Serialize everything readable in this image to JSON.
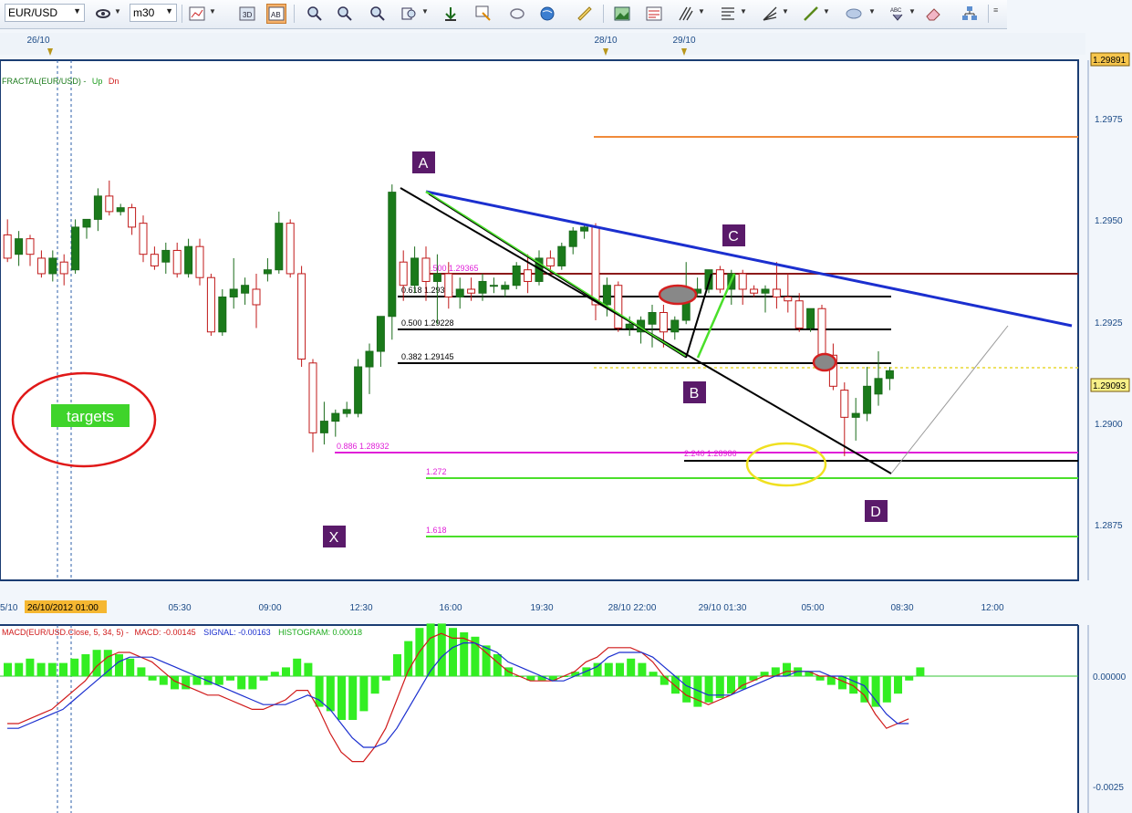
{
  "toolbar": {
    "symbol": "EUR/USD",
    "timeframe": "m30",
    "buttons": [
      "crosshair-icon",
      "bar-chart-icon",
      "candle-chart-icon",
      "line-chart-icon",
      "zoom-in-icon",
      "zoom-out-icon",
      "zoom-icon",
      "scroll-end-icon",
      "bring-to-front-icon",
      "hand-icon",
      "globe-icon",
      "ruler-icon",
      "image-icon",
      "template-icon",
      "trend-tool-icon",
      "fibonacci-icon",
      "gann-fan-icon",
      "line-icon",
      "ellipse-icon",
      "text-icon",
      "eraser-icon",
      "objects-icon"
    ]
  },
  "main_chart": {
    "indicator_label": "FRACTAL(EUR/USD) -",
    "indicator_up": "Up",
    "indicator_dn": "Dn",
    "price_axis": [
      "1.2975",
      "1.2950",
      "1.2925",
      "1.2900",
      "1.2875"
    ],
    "price_top_flag": "1.29891",
    "price_current_flag": "1.29093",
    "date_markers": [
      "26/10",
      "28/10",
      "29/10"
    ],
    "time_axis": [
      "5/10",
      "05:30",
      "09:00",
      "12:30",
      "16:00",
      "19:30",
      "28/10 22:00",
      "29/10 01:30",
      "05:00",
      "08:30",
      "12:00"
    ],
    "cursor_time": "26/10/2012 01:00",
    "pattern_points": {
      "A": "A",
      "B": "B",
      "C": "C",
      "D": "D",
      "X": "X"
    },
    "targets_label": "targets",
    "fib_labels": {
      "f500_top": "0.500 1.29365",
      "f618": "0.618 1.29311",
      "f500": "0.500 1.29228",
      "f382": "0.382 1.29145",
      "f886": "0.886 1.28932",
      "f2240": "2.240 1.28986",
      "f1272": "1.272",
      "f1618": "1.618"
    }
  },
  "macd_panel": {
    "label_name": "MACD(EUR/USD.Close, 5, 34, 5) -",
    "label_macd": "MACD: -0.00145",
    "label_signal": "SIGNAL: -0.00163",
    "label_hist": "HISTOGRAM: 0.00018",
    "axis": [
      "0.00000",
      "-0.0025"
    ]
  },
  "chart_data": {
    "type": "candlestick",
    "symbol": "EUR/USD",
    "timeframe": "m30",
    "ylim": [
      1.2856,
      1.299
    ],
    "candles": [
      {
        "o": 1.2945,
        "h": 1.2949,
        "l": 1.2938,
        "c": 1.2939
      },
      {
        "o": 1.294,
        "h": 1.2946,
        "l": 1.2937,
        "c": 1.2944
      },
      {
        "o": 1.2944,
        "h": 1.2945,
        "l": 1.2937,
        "c": 1.294
      },
      {
        "o": 1.2939,
        "h": 1.2941,
        "l": 1.2934,
        "c": 1.2935
      },
      {
        "o": 1.2935,
        "h": 1.2941,
        "l": 1.2933,
        "c": 1.2939
      },
      {
        "o": 1.2938,
        "h": 1.294,
        "l": 1.2932,
        "c": 1.2935
      },
      {
        "o": 1.2936,
        "h": 1.2949,
        "l": 1.2935,
        "c": 1.2947
      },
      {
        "o": 1.2947,
        "h": 1.2949,
        "l": 1.2944,
        "c": 1.2949
      },
      {
        "o": 1.2949,
        "h": 1.2957,
        "l": 1.2946,
        "c": 1.2955
      },
      {
        "o": 1.2955,
        "h": 1.2959,
        "l": 1.295,
        "c": 1.2951
      },
      {
        "o": 1.2951,
        "h": 1.2953,
        "l": 1.295,
        "c": 1.2952
      },
      {
        "o": 1.2952,
        "h": 1.2953,
        "l": 1.2945,
        "c": 1.2947
      },
      {
        "o": 1.2948,
        "h": 1.295,
        "l": 1.2938,
        "c": 1.294
      },
      {
        "o": 1.294,
        "h": 1.2942,
        "l": 1.2936,
        "c": 1.2937
      },
      {
        "o": 1.2938,
        "h": 1.2943,
        "l": 1.2935,
        "c": 1.2941
      },
      {
        "o": 1.2941,
        "h": 1.2943,
        "l": 1.2934,
        "c": 1.2935
      },
      {
        "o": 1.2935,
        "h": 1.2944,
        "l": 1.2934,
        "c": 1.2942
      },
      {
        "o": 1.2942,
        "h": 1.2944,
        "l": 1.2932,
        "c": 1.2934
      },
      {
        "o": 1.2934,
        "h": 1.2935,
        "l": 1.2919,
        "c": 1.292
      },
      {
        "o": 1.292,
        "h": 1.2931,
        "l": 1.2919,
        "c": 1.2929
      },
      {
        "o": 1.2929,
        "h": 1.2939,
        "l": 1.2926,
        "c": 1.2931
      },
      {
        "o": 1.293,
        "h": 1.2934,
        "l": 1.2927,
        "c": 1.2932
      },
      {
        "o": 1.2931,
        "h": 1.2935,
        "l": 1.2921,
        "c": 1.2927
      },
      {
        "o": 1.2935,
        "h": 1.2939,
        "l": 1.2933,
        "c": 1.2936
      },
      {
        "o": 1.2936,
        "h": 1.2951,
        "l": 1.2935,
        "c": 1.2948
      },
      {
        "o": 1.2948,
        "h": 1.2949,
        "l": 1.2934,
        "c": 1.2935
      },
      {
        "o": 1.2935,
        "h": 1.2937,
        "l": 1.2911,
        "c": 1.2913
      },
      {
        "o": 1.2912,
        "h": 1.2913,
        "l": 1.2889,
        "c": 1.2894
      },
      {
        "o": 1.2894,
        "h": 1.2902,
        "l": 1.2891,
        "c": 1.2897
      },
      {
        "o": 1.2897,
        "h": 1.29,
        "l": 1.2893,
        "c": 1.2899
      },
      {
        "o": 1.2899,
        "h": 1.2902,
        "l": 1.2898,
        "c": 1.29
      },
      {
        "o": 1.2899,
        "h": 1.2913,
        "l": 1.2898,
        "c": 1.2911
      },
      {
        "o": 1.2911,
        "h": 1.2917,
        "l": 1.2904,
        "c": 1.2915
      },
      {
        "o": 1.2915,
        "h": 1.2924,
        "l": 1.2911,
        "c": 1.2924
      },
      {
        "o": 1.2924,
        "h": 1.2958,
        "l": 1.2918,
        "c": 1.2956
      },
      {
        "o": 1.2938,
        "h": 1.2941,
        "l": 1.2928,
        "c": 1.2932
      },
      {
        "o": 1.2932,
        "h": 1.2942,
        "l": 1.293,
        "c": 1.2939
      },
      {
        "o": 1.2939,
        "h": 1.2942,
        "l": 1.2928,
        "c": 1.2933
      },
      {
        "o": 1.2933,
        "h": 1.294,
        "l": 1.2922,
        "c": 1.2935
      },
      {
        "o": 1.2935,
        "h": 1.2938,
        "l": 1.2926,
        "c": 1.2929
      },
      {
        "o": 1.2929,
        "h": 1.2934,
        "l": 1.2926,
        "c": 1.2931
      },
      {
        "o": 1.2931,
        "h": 1.2934,
        "l": 1.2928,
        "c": 1.293
      },
      {
        "o": 1.293,
        "h": 1.2935,
        "l": 1.2928,
        "c": 1.2933
      },
      {
        "o": 1.2932,
        "h": 1.2934,
        "l": 1.293,
        "c": 1.2932
      },
      {
        "o": 1.2931,
        "h": 1.2933,
        "l": 1.2929,
        "c": 1.2932
      },
      {
        "o": 1.2932,
        "h": 1.2938,
        "l": 1.2931,
        "c": 1.2937
      },
      {
        "o": 1.2936,
        "h": 1.294,
        "l": 1.293,
        "c": 1.2933
      },
      {
        "o": 1.2933,
        "h": 1.2941,
        "l": 1.2932,
        "c": 1.2939
      },
      {
        "o": 1.2939,
        "h": 1.2941,
        "l": 1.2935,
        "c": 1.2937
      },
      {
        "o": 1.2937,
        "h": 1.2943,
        "l": 1.2936,
        "c": 1.2942
      },
      {
        "o": 1.2942,
        "h": 1.2947,
        "l": 1.294,
        "c": 1.2946
      },
      {
        "o": 1.2946,
        "h": 1.2948,
        "l": 1.2944,
        "c": 1.2947
      },
      {
        "o": 1.2947,
        "h": 1.2948,
        "l": 1.2923,
        "c": 1.2927
      },
      {
        "o": 1.2927,
        "h": 1.2934,
        "l": 1.2924,
        "c": 1.2932
      },
      {
        "o": 1.2932,
        "h": 1.2933,
        "l": 1.292,
        "c": 1.2921
      },
      {
        "o": 1.2921,
        "h": 1.2924,
        "l": 1.2919,
        "c": 1.2922
      },
      {
        "o": 1.292,
        "h": 1.2924,
        "l": 1.2917,
        "c": 1.2923
      },
      {
        "o": 1.2922,
        "h": 1.2927,
        "l": 1.2916,
        "c": 1.2925
      },
      {
        "o": 1.2925,
        "h": 1.2927,
        "l": 1.2916,
        "c": 1.292
      },
      {
        "o": 1.292,
        "h": 1.2924,
        "l": 1.2918,
        "c": 1.2923
      },
      {
        "o": 1.2923,
        "h": 1.2938,
        "l": 1.2922,
        "c": 1.293
      },
      {
        "o": 1.293,
        "h": 1.2934,
        "l": 1.2929,
        "c": 1.2931
      },
      {
        "o": 1.2931,
        "h": 1.2935,
        "l": 1.293,
        "c": 1.2936
      },
      {
        "o": 1.2936,
        "h": 1.2937,
        "l": 1.293,
        "c": 1.2931
      },
      {
        "o": 1.2931,
        "h": 1.2936,
        "l": 1.2927,
        "c": 1.2935
      },
      {
        "o": 1.2935,
        "h": 1.2936,
        "l": 1.2927,
        "c": 1.2931
      },
      {
        "o": 1.2931,
        "h": 1.2932,
        "l": 1.2929,
        "c": 1.293
      },
      {
        "o": 1.293,
        "h": 1.2932,
        "l": 1.2925,
        "c": 1.2931
      },
      {
        "o": 1.2931,
        "h": 1.2938,
        "l": 1.2926,
        "c": 1.2929
      },
      {
        "o": 1.2929,
        "h": 1.2935,
        "l": 1.2925,
        "c": 1.2928
      },
      {
        "o": 1.2928,
        "h": 1.293,
        "l": 1.292,
        "c": 1.2921
      },
      {
        "o": 1.2921,
        "h": 1.2926,
        "l": 1.292,
        "c": 1.2926
      },
      {
        "o": 1.2926,
        "h": 1.2927,
        "l": 1.2913,
        "c": 1.2914
      },
      {
        "o": 1.2914,
        "h": 1.2917,
        "l": 1.2905,
        "c": 1.2906
      },
      {
        "o": 1.2905,
        "h": 1.2907,
        "l": 1.2888,
        "c": 1.2898
      },
      {
        "o": 1.2898,
        "h": 1.2903,
        "l": 1.2892,
        "c": 1.2899
      },
      {
        "o": 1.2899,
        "h": 1.2911,
        "l": 1.2897,
        "c": 1.2906
      },
      {
        "o": 1.2904,
        "h": 1.2915,
        "l": 1.2901,
        "c": 1.2908
      },
      {
        "o": 1.2908,
        "h": 1.2911,
        "l": 1.2905,
        "c": 1.291
      }
    ],
    "macd": {
      "histogram": [
        3,
        3,
        4,
        3,
        3,
        3,
        4,
        5,
        6,
        6,
        5,
        4,
        2,
        -1,
        -2,
        -3,
        -3,
        -2,
        -2,
        -2,
        -1,
        -3,
        -3,
        -1,
        1,
        2,
        4,
        3,
        -7,
        -8,
        -10,
        -10,
        -8,
        -4,
        -1,
        5,
        8,
        11,
        12,
        12,
        11,
        10,
        9,
        7,
        5,
        2,
        0,
        -1,
        -1,
        -1,
        0,
        1,
        2,
        3,
        3,
        3,
        4,
        3,
        1,
        -2,
        -4,
        -6,
        -7,
        -6,
        -5,
        -4,
        -3,
        -1,
        1,
        2,
        3,
        2,
        1,
        -1,
        -2,
        -3,
        -4,
        -6,
        -7,
        -6,
        -4,
        -1,
        2
      ],
      "macd": [
        -10,
        -10,
        -9,
        -8,
        -7,
        -5,
        -3,
        -1,
        2,
        4,
        5,
        5,
        4,
        3,
        1,
        -1,
        -2,
        -3,
        -4,
        -4,
        -5,
        -6,
        -7,
        -7,
        -6,
        -5,
        -3,
        -3,
        -7,
        -12,
        -16,
        -18,
        -18,
        -15,
        -11,
        -5,
        1,
        5,
        8,
        9,
        8,
        8,
        7,
        5,
        3,
        1,
        0,
        -1,
        -1,
        -1,
        0,
        1,
        3,
        4,
        6,
        6,
        6,
        5,
        3,
        0,
        -2,
        -4,
        -5,
        -6,
        -5,
        -4,
        -2,
        -1,
        0,
        0,
        1,
        1,
        1,
        0,
        0,
        -1,
        -2,
        -4,
        -8,
        -11,
        -10,
        -9
      ],
      "signal": [
        -11,
        -11,
        -10,
        -9,
        -8,
        -7,
        -5,
        -3,
        -1,
        1,
        3,
        4,
        4,
        4,
        3,
        2,
        1,
        0,
        -1,
        -2,
        -3,
        -4,
        -5,
        -6,
        -6,
        -6,
        -5,
        -4,
        -5,
        -7,
        -10,
        -13,
        -15,
        -15,
        -14,
        -11,
        -7,
        -3,
        1,
        4,
        6,
        7,
        7,
        6,
        5,
        3,
        2,
        1,
        0,
        -1,
        -1,
        0,
        1,
        2,
        4,
        5,
        5,
        5,
        4,
        2,
        0,
        -2,
        -3,
        -4,
        -4,
        -4,
        -3,
        -2,
        -1,
        0,
        0,
        1,
        1,
        1,
        0,
        0,
        -1,
        -2,
        -5,
        -8,
        -10,
        -10
      ]
    }
  }
}
